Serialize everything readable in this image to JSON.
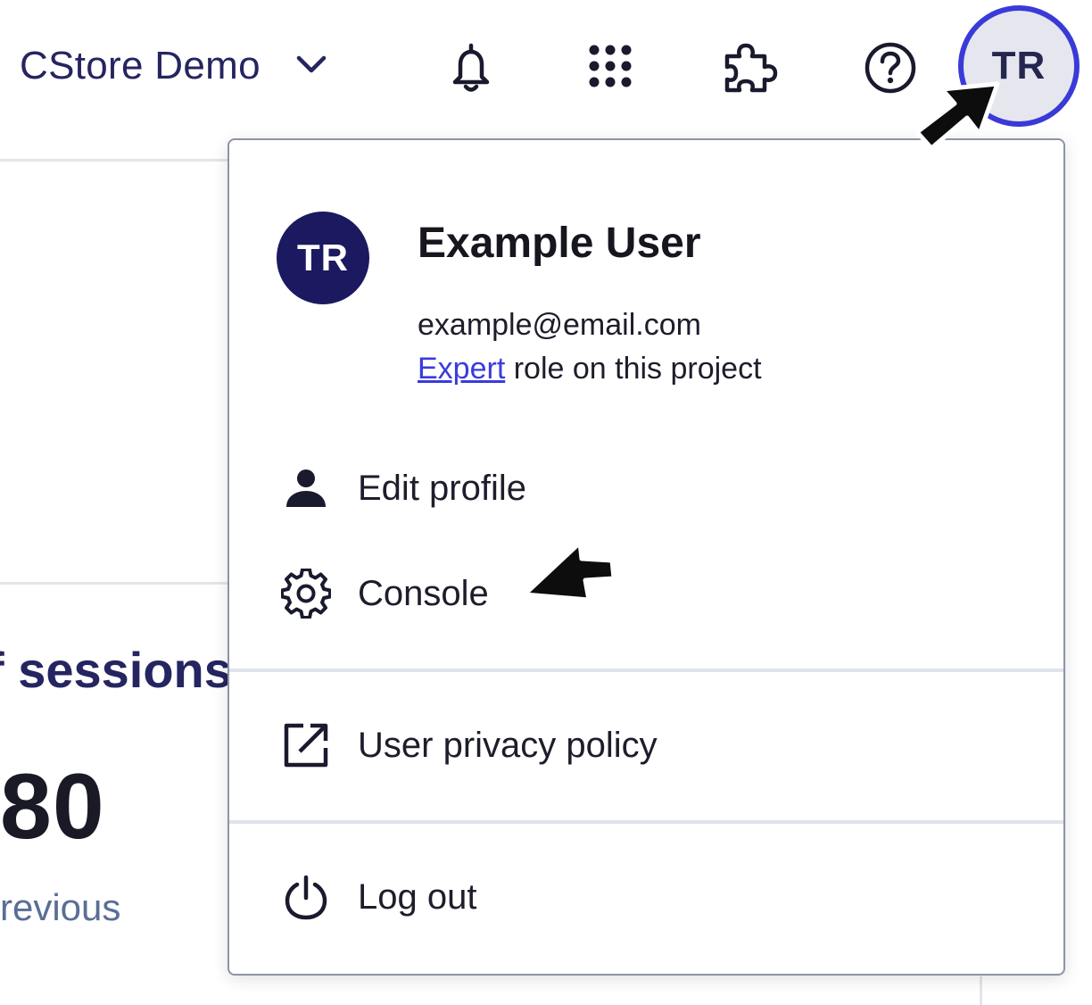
{
  "header": {
    "project_name": "CStore Demo",
    "icons": [
      "chevron-down-icon",
      "bell-icon",
      "apps-grid-icon",
      "puzzle-icon",
      "help-icon"
    ],
    "avatar_initials": "TR",
    "accent_color": "#3a3ad8"
  },
  "background": {
    "heading": "f sessions",
    "value": "80",
    "subtext": "revious"
  },
  "menu": {
    "user": {
      "initials": "TR",
      "name": "Example User",
      "email": "example@email.com",
      "role_link": "Expert",
      "role_suffix": " role on this project",
      "avatar_color": "#1b1960"
    },
    "items": [
      {
        "label": "Edit profile",
        "icon": "person-icon"
      },
      {
        "label": "Console",
        "icon": "gear-icon"
      },
      {
        "label": "User privacy policy",
        "icon": "external-link-icon"
      },
      {
        "label": "Log out",
        "icon": "power-icon"
      }
    ]
  }
}
